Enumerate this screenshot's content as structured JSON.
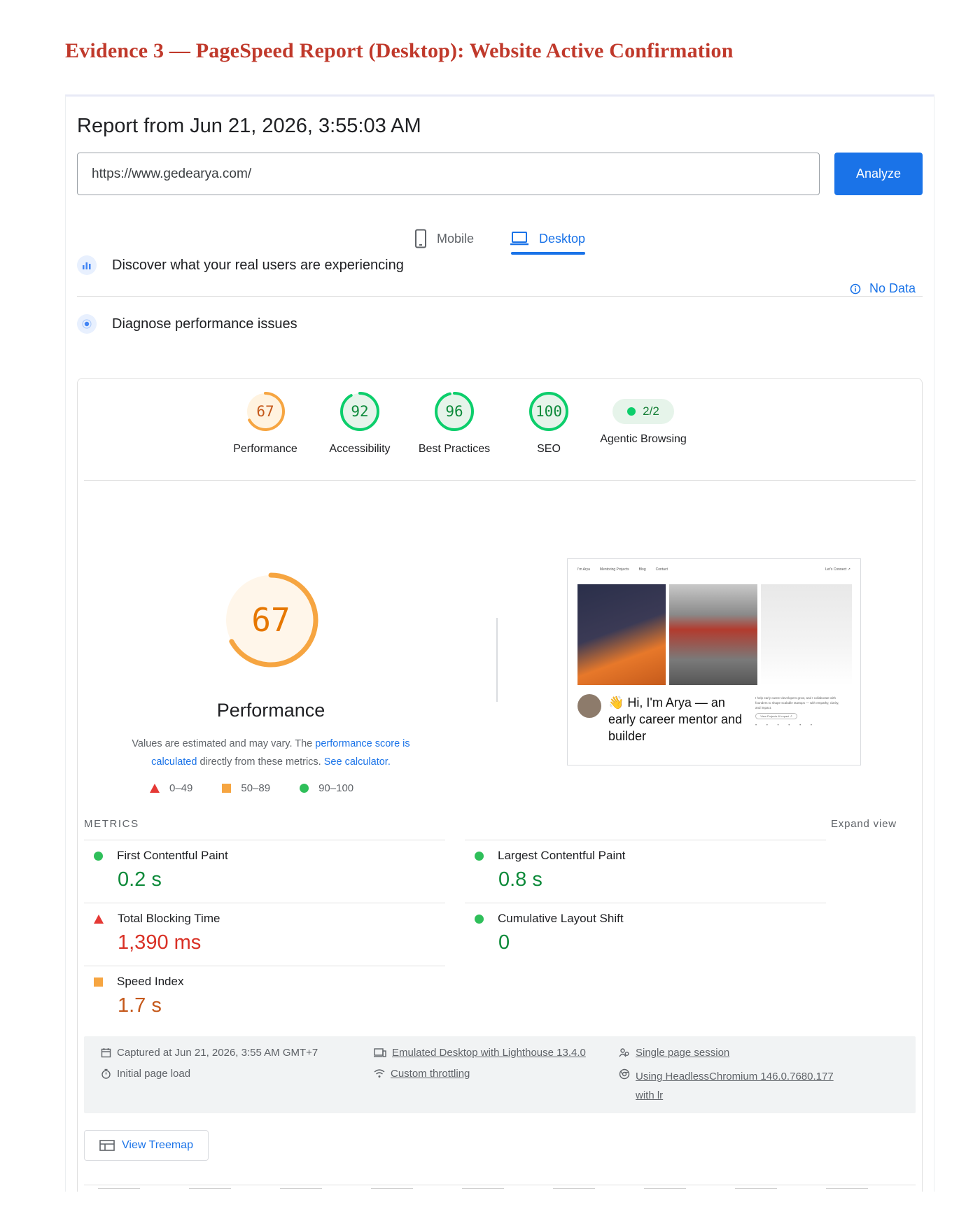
{
  "doc_title": "Evidence 3 — PageSpeed Report (Desktop): Website Active Confirmation",
  "report_title": "Report from Jun 21, 2026, 3:55:03 AM",
  "url_input": {
    "value": "https://www.gedearya.com/"
  },
  "analyze_label": "Analyze",
  "device_tabs": {
    "mobile": "Mobile",
    "desktop": "Desktop",
    "selected": "Desktop"
  },
  "real_users": {
    "label": "Discover what your real users are experiencing",
    "status": "No Data"
  },
  "diagnose": {
    "label": "Diagnose performance issues"
  },
  "scores": [
    {
      "value": "67",
      "label": "Performance",
      "color": "#f6a541",
      "fraction": 0.67
    },
    {
      "value": "92",
      "label": "Accessibility",
      "color": "#0cce6b",
      "fraction": 0.92
    },
    {
      "value": "96",
      "label": "Best Practices",
      "color": "#0cce6b",
      "fraction": 0.96
    },
    {
      "value": "100",
      "label": "SEO",
      "color": "#0cce6b",
      "fraction": 1.0
    }
  ],
  "agentic": {
    "value": "2/2",
    "label": "Agentic Browsing"
  },
  "performance_detail": {
    "score": "67",
    "score_fraction": 0.67,
    "title": "Performance",
    "note_before": "Values are estimated and may vary. The ",
    "note_link1": "performance score is calculated",
    "note_middle": " directly from these metrics. ",
    "note_link2": "See calculator."
  },
  "legend": {
    "bad": "0–49",
    "average": "50–89",
    "good": "90–100"
  },
  "screenshot": {
    "nav_left": "I'm Arya",
    "nav_items": [
      "Mentoring Projects",
      "Blog",
      "Contact"
    ],
    "nav_right": "Let's Connect ↗",
    "headline": "👋 Hi, I'm Arya — an early career mentor and builder",
    "side_text": "I help early career developers grow, and I collaborate with founders to shape scalable startups — with empathy, clarity, and impact.",
    "side_button": "View Projects & Impact ↗"
  },
  "metrics": {
    "heading": "METRICS",
    "expand": "Expand view",
    "fcp": {
      "label": "First Contentful Paint",
      "value": "0.2 s"
    },
    "lcp": {
      "label": "Largest Contentful Paint",
      "value": "0.8 s"
    },
    "tbt": {
      "label": "Total Blocking Time",
      "value": "1,390 ms"
    },
    "cls": {
      "label": "Cumulative Layout Shift",
      "value": "0"
    },
    "si": {
      "label": "Speed Index",
      "value": "1.7 s"
    }
  },
  "run_info": {
    "captured": "Captured at Jun 21, 2026, 3:55 AM GMT+7",
    "initial_load": "Initial page load",
    "emulated": "Emulated Desktop with Lighthouse 13.4.0",
    "throttling": "Custom throttling",
    "session": "Single page session",
    "browser": "Using HeadlessChromium 146.0.7680.177 with lr"
  },
  "treemap_label": "View Treemap"
}
